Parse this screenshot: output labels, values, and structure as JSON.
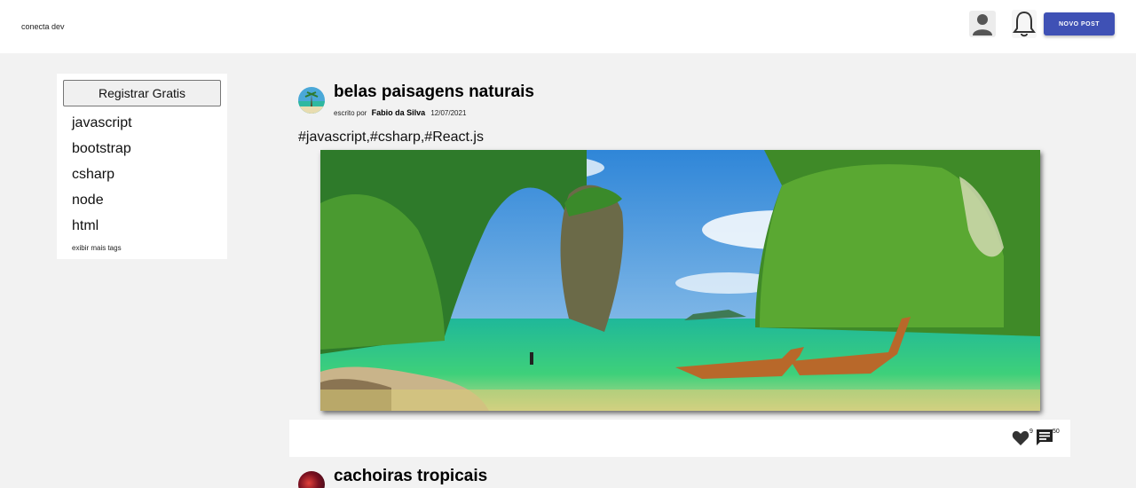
{
  "header": {
    "brand": "conecta dev",
    "new_post_label": "NOVO POST"
  },
  "sidebar": {
    "register_label": "Registrar Gratis",
    "tags": [
      "javascript",
      "bootstrap",
      "csharp",
      "node",
      "html"
    ],
    "more_tags_label": "exibir mais tags"
  },
  "posts": [
    {
      "title": "belas paisagens naturais",
      "written_by_label": "escrito por",
      "author": "Fabio da Silva",
      "date": "12/07/2021",
      "tags": "#javascript,#csharp,#React.js",
      "likes": "9",
      "comments": "50"
    },
    {
      "title": "cachoiras tropicais"
    }
  ],
  "icons": {
    "user": "user-icon",
    "bell": "bell-icon",
    "like": "heart-icon",
    "comment": "comment-icon"
  },
  "colors": {
    "primary": "#3f51b5",
    "background": "#f2f2f2",
    "surface": "#ffffff"
  }
}
